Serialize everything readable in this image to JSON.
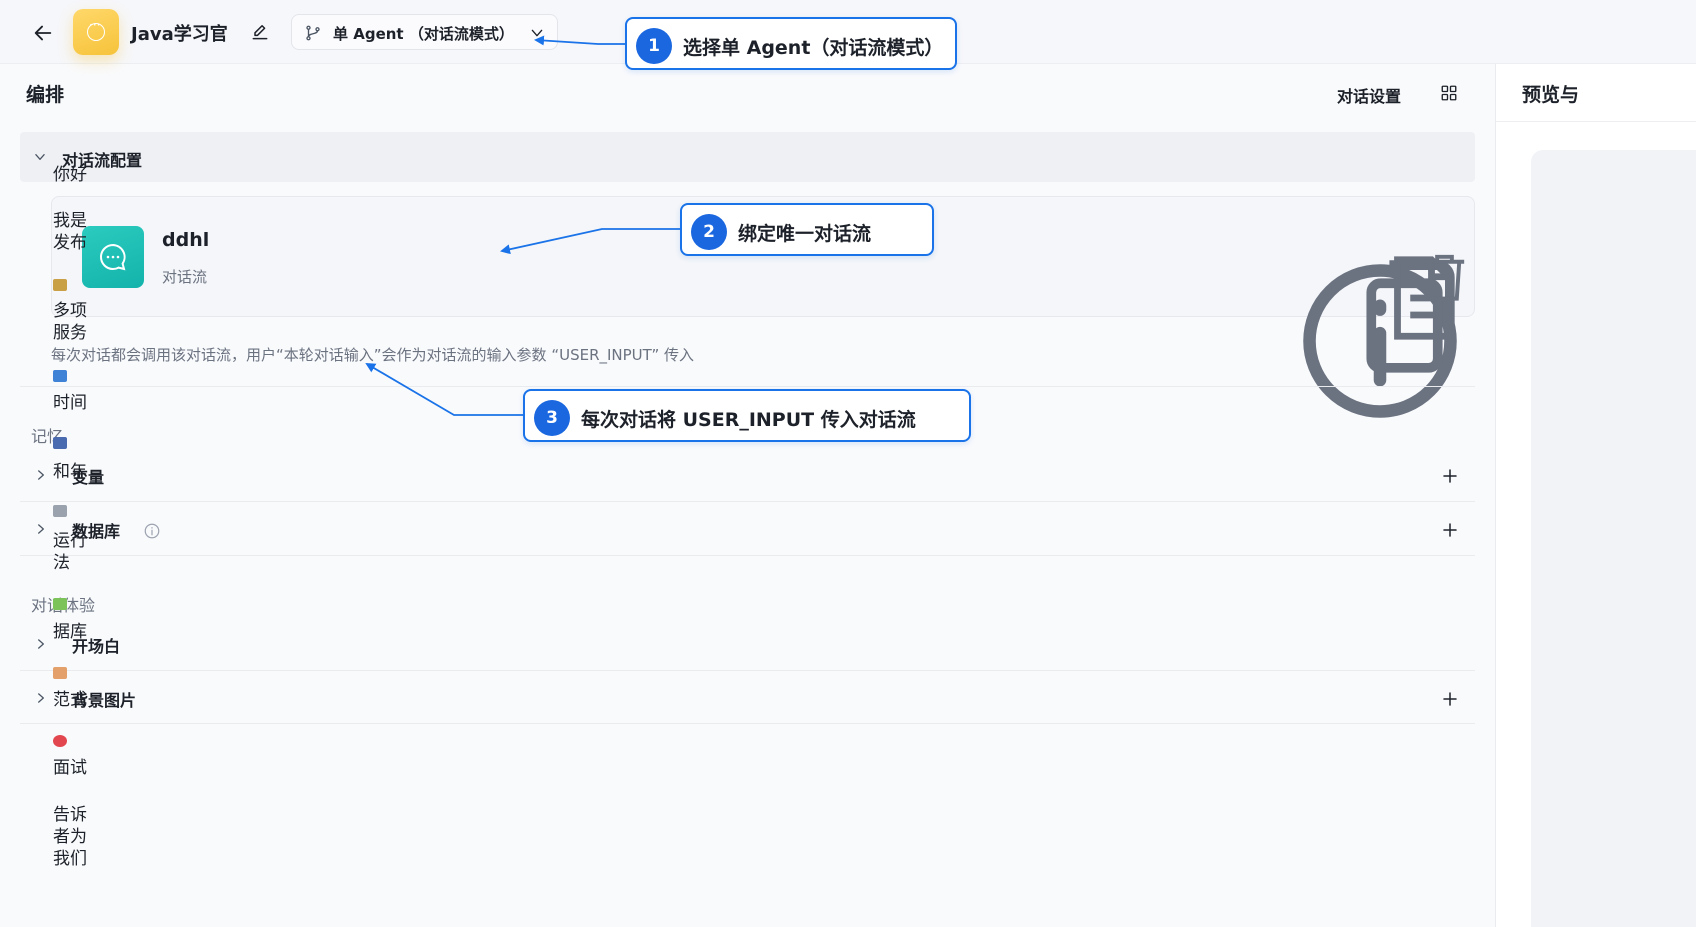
{
  "header": {
    "app_name": "Java学习官",
    "mode_label": "单 Agent （对话流模式）"
  },
  "main": {
    "title": "编排",
    "dialog_settings": "对话设置",
    "dialog_flow_section": "对话流配置",
    "flow_card": {
      "name": "ddhl",
      "type": "对话流"
    },
    "flow_description": "每次对话都会调用该对话流，用户“本轮对话输入”会作为对话流的输入参数 “USER_INPUT” 传入",
    "memory_group": "记忆",
    "memory_items": [
      {
        "label": "变量"
      },
      {
        "label": "数据库"
      }
    ],
    "experience_group": "对话体验",
    "experience_items": [
      {
        "label": "开场白"
      },
      {
        "label": "背景图片"
      }
    ]
  },
  "preview": {
    "title": "预览与",
    "lines": [
      "你好",
      "我是",
      "发布",
      "多项",
      "服务",
      "时间",
      "和年",
      "运行",
      "法",
      "据库",
      "范式",
      "面试",
      "告诉",
      "者为",
      "我们"
    ]
  },
  "annotations": [
    {
      "number": "1",
      "text": "选择单 Agent（对话流模式）"
    },
    {
      "number": "2",
      "text": "绑定唯一对话流"
    },
    {
      "number": "3",
      "text": "每次对话将 USER_INPUT 传入对话流"
    }
  ],
  "colors": {
    "accent_blue": "#1a73e8",
    "app_icon_yellow": "#f6c33a",
    "flow_icon_teal": "#1bbdb4"
  }
}
